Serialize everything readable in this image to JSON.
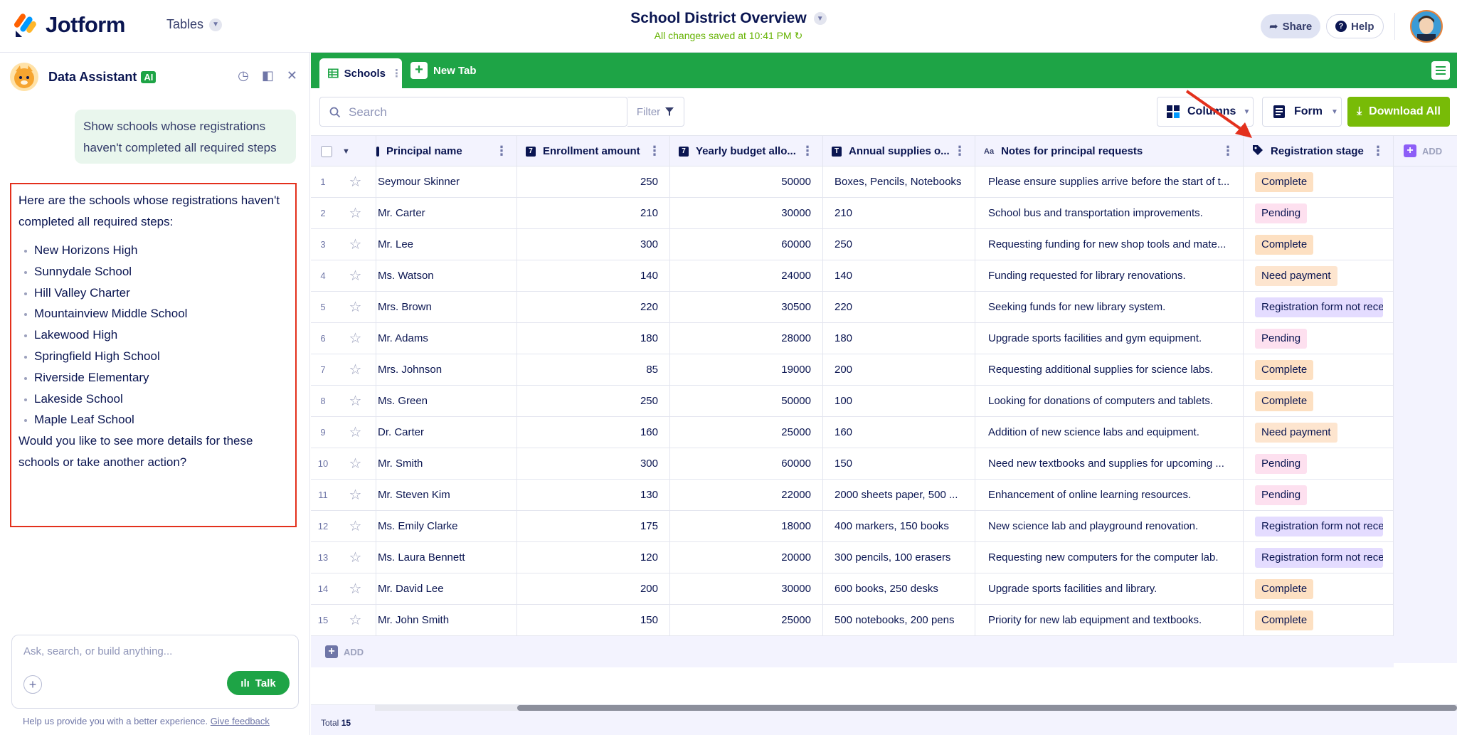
{
  "header": {
    "brand": "Jotform",
    "tables_label": "Tables",
    "doc_title": "School District Overview",
    "save_status": "All changes saved at 10:41 PM",
    "share_label": "Share",
    "help_label": "Help"
  },
  "assistant": {
    "name": "Data Assistant",
    "badge": "AI",
    "user_message": "Show schools whose registrations haven't completed all required steps",
    "answer_intro": "Here are the schools whose registrations haven't completed all required steps:",
    "schools": [
      "New Horizons High",
      "Sunnydale School",
      "Hill Valley Charter",
      "Mountainview Middle School",
      "Lakewood High",
      "Springfield High School",
      "Riverside Elementary",
      "Lakeside School",
      "Maple Leaf School"
    ],
    "answer_outro": "Would you like to see more details for these schools or take another action?",
    "input_placeholder": "Ask, search, or build anything...",
    "talk_label": "Talk",
    "feedback_text": "Help us provide you with a better experience.",
    "feedback_link": "Give feedback"
  },
  "tabs": {
    "active": "Schools",
    "new_tab": "New Tab"
  },
  "toolbar": {
    "search_placeholder": "Search",
    "filter_label": "Filter",
    "columns_label": "Columns",
    "form_label": "Form",
    "download_label": "Download All"
  },
  "table": {
    "columns": [
      {
        "label": "Principal name",
        "type": "text"
      },
      {
        "label": "Enrollment amount",
        "type": "number",
        "icon": "7"
      },
      {
        "label": "Yearly budget allo...",
        "type": "number",
        "icon": "7"
      },
      {
        "label": "Annual supplies o...",
        "type": "text",
        "icon": "T"
      },
      {
        "label": "Notes for principal requests",
        "type": "text",
        "icon": "Aa"
      },
      {
        "label": "Registration stage",
        "type": "tag"
      }
    ],
    "add_column_label": "ADD",
    "add_row_label": "ADD",
    "rows": [
      {
        "n": "1",
        "principal": "Seymour Skinner",
        "enroll": "250",
        "budget": "50000",
        "supplies": "Boxes, Pencils, Notebooks",
        "notes": "Please ensure supplies arrive before the start of t...",
        "stage": "Complete",
        "kind": "complete"
      },
      {
        "n": "2",
        "principal": "Mr. Carter",
        "enroll": "210",
        "budget": "30000",
        "supplies": "210",
        "notes": "School bus and transportation improvements.",
        "stage": "Pending",
        "kind": "pending"
      },
      {
        "n": "3",
        "principal": "Mr. Lee",
        "enroll": "300",
        "budget": "60000",
        "supplies": "250",
        "notes": "Requesting funding for new shop tools and mate...",
        "stage": "Complete",
        "kind": "complete"
      },
      {
        "n": "4",
        "principal": "Ms. Watson",
        "enroll": "140",
        "budget": "24000",
        "supplies": "140",
        "notes": "Funding requested for library renovations.",
        "stage": "Need payment",
        "kind": "need"
      },
      {
        "n": "5",
        "principal": "Mrs. Brown",
        "enroll": "220",
        "budget": "30500",
        "supplies": "220",
        "notes": "Seeking funds for new library system.",
        "stage": "Registration form not rece",
        "kind": "reg"
      },
      {
        "n": "6",
        "principal": "Mr. Adams",
        "enroll": "180",
        "budget": "28000",
        "supplies": "180",
        "notes": "Upgrade sports facilities and gym equipment.",
        "stage": "Pending",
        "kind": "pending"
      },
      {
        "n": "7",
        "principal": "Mrs. Johnson",
        "enroll": "85",
        "budget": "19000",
        "supplies": "200",
        "notes": "Requesting additional supplies for science labs.",
        "stage": "Complete",
        "kind": "complete"
      },
      {
        "n": "8",
        "principal": "Ms. Green",
        "enroll": "250",
        "budget": "50000",
        "supplies": "100",
        "notes": "Looking for donations of computers and tablets.",
        "stage": "Complete",
        "kind": "complete"
      },
      {
        "n": "9",
        "principal": "Dr. Carter",
        "enroll": "160",
        "budget": "25000",
        "supplies": "160",
        "notes": "Addition of new science labs and equipment.",
        "stage": "Need payment",
        "kind": "need"
      },
      {
        "n": "10",
        "principal": "Mr. Smith",
        "enroll": "300",
        "budget": "60000",
        "supplies": "150",
        "notes": "Need new textbooks and supplies for upcoming ...",
        "stage": "Pending",
        "kind": "pending"
      },
      {
        "n": "11",
        "principal": "Mr. Steven Kim",
        "enroll": "130",
        "budget": "22000",
        "supplies": "2000 sheets paper, 500 ...",
        "notes": "Enhancement of online learning resources.",
        "stage": "Pending",
        "kind": "pending"
      },
      {
        "n": "12",
        "principal": "Ms. Emily Clarke",
        "enroll": "175",
        "budget": "18000",
        "supplies": "400 markers, 150 books",
        "notes": "New science lab and playground renovation.",
        "stage": "Registration form not rece",
        "kind": "reg"
      },
      {
        "n": "13",
        "principal": "Ms. Laura Bennett",
        "enroll": "120",
        "budget": "20000",
        "supplies": "300 pencils, 100 erasers",
        "notes": "Requesting new computers for the computer lab.",
        "stage": "Registration form not rece",
        "kind": "reg"
      },
      {
        "n": "14",
        "principal": "Mr. David Lee",
        "enroll": "200",
        "budget": "30000",
        "supplies": "600 books, 250 desks",
        "notes": "Upgrade sports facilities and library.",
        "stage": "Complete",
        "kind": "complete"
      },
      {
        "n": "15",
        "principal": "Mr. John Smith",
        "enroll": "150",
        "budget": "25000",
        "supplies": "500 notebooks, 200 pens",
        "notes": "Priority for new lab equipment and textbooks.",
        "stage": "Complete",
        "kind": "complete"
      }
    ]
  },
  "footer": {
    "total_label": "Total",
    "total_count": "15"
  },
  "colors": {
    "brand_green": "#1ea446",
    "download_green": "#78bb07",
    "highlight_red": "#e3301c",
    "navy": "#0a1551"
  }
}
